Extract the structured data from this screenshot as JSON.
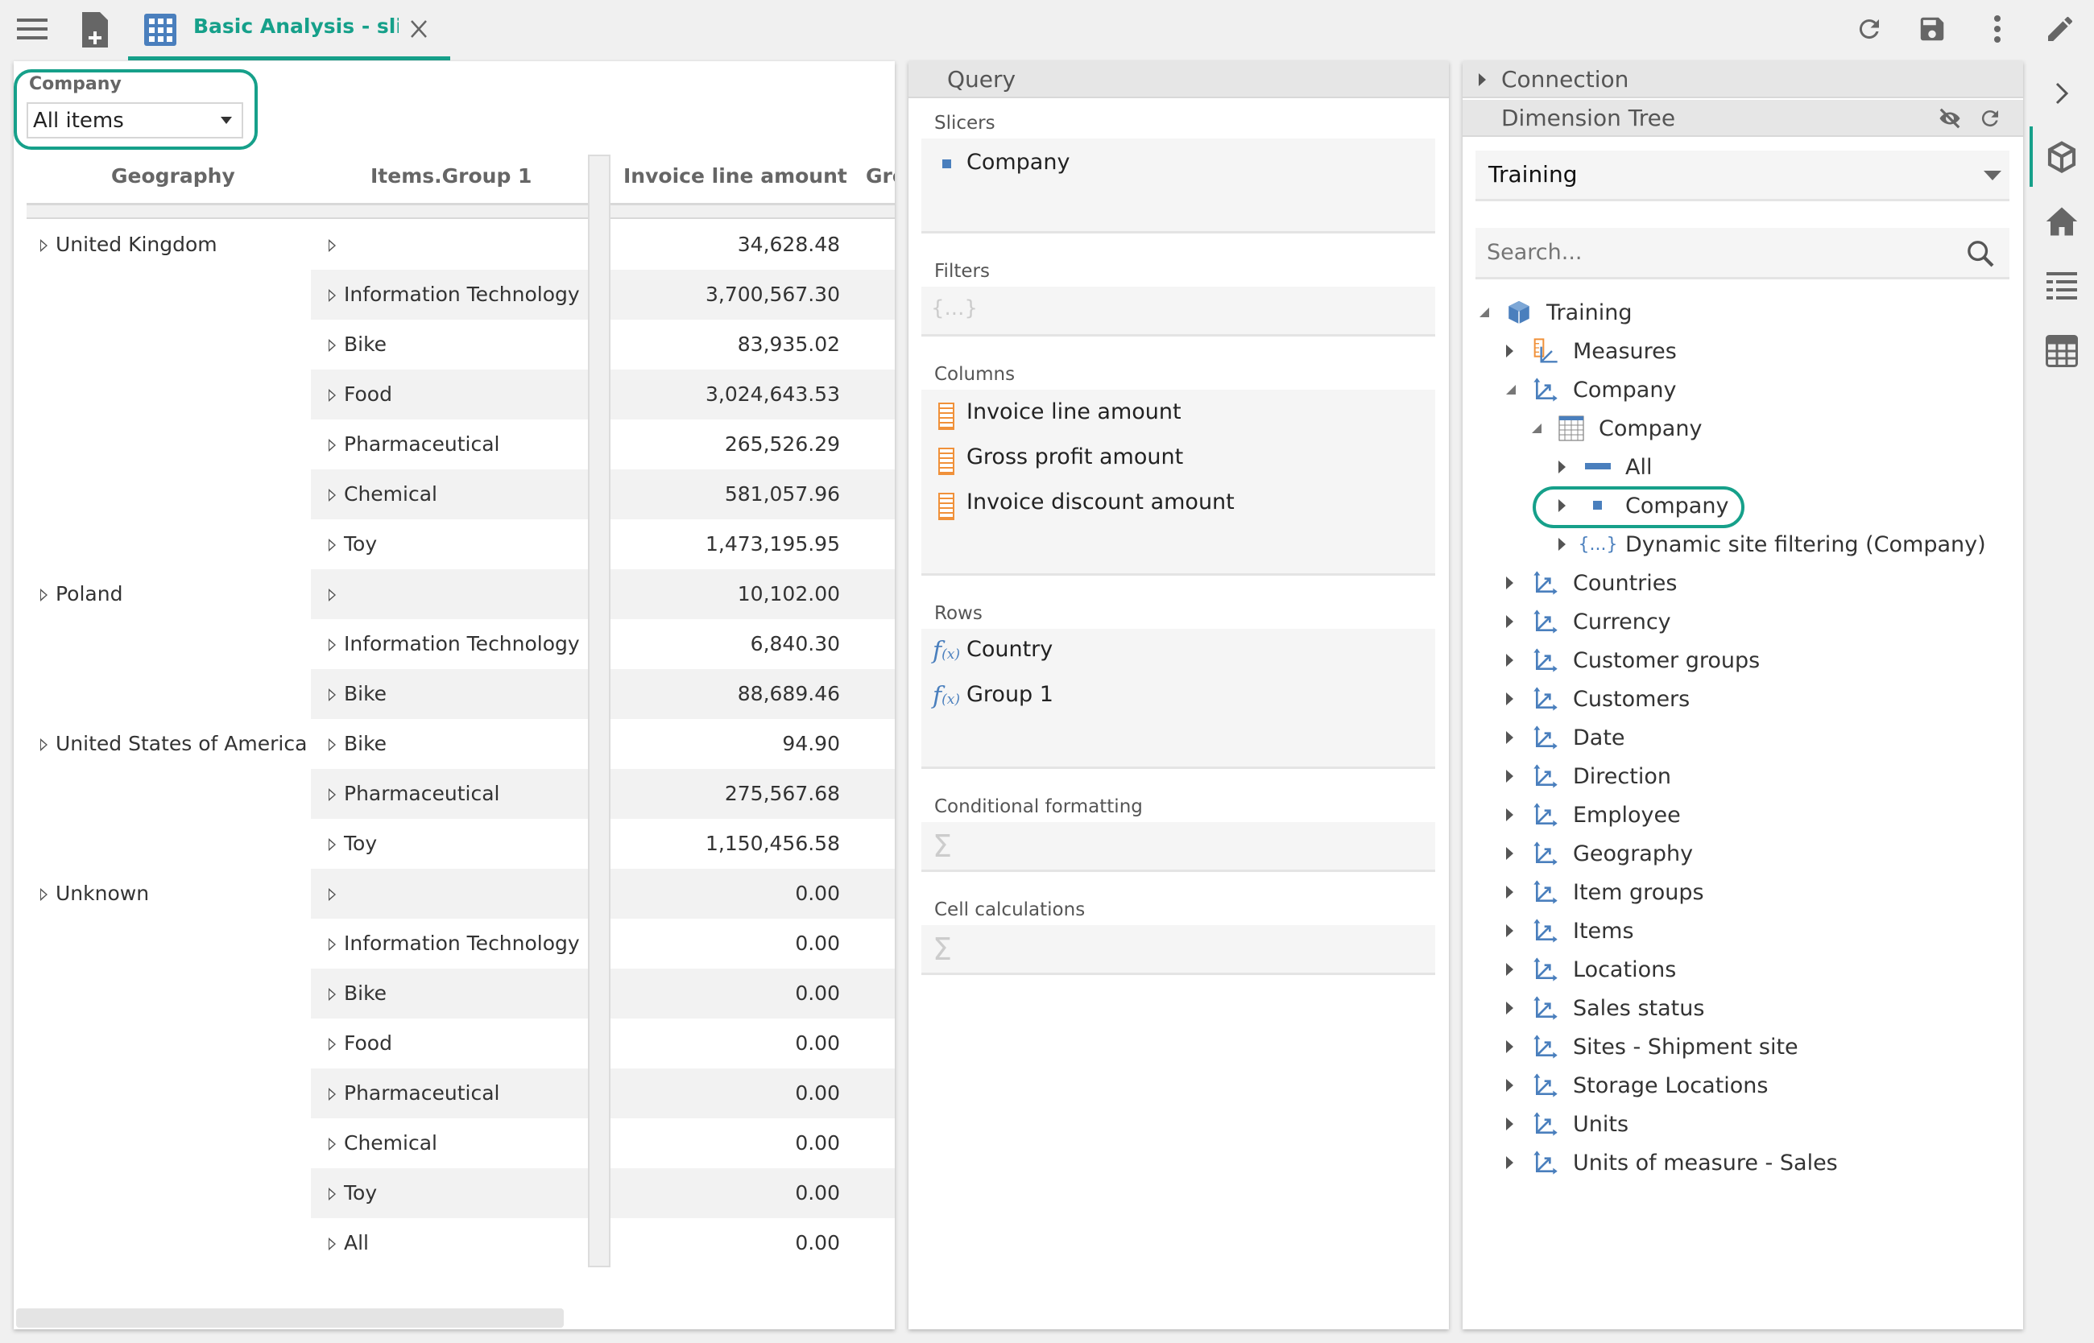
{
  "toolbar": {
    "tab_title": "Basic Analysis - sliced",
    "icons": [
      "hamburger-menu-icon",
      "new-document-icon",
      "grid-icon",
      "close-icon",
      "refresh-icon",
      "save-icon",
      "more-vertical-icon",
      "pencil-icon"
    ]
  },
  "slicer": {
    "label": "Company",
    "value": "All items"
  },
  "table": {
    "headers": [
      "Geography",
      "Items.Group 1",
      "Invoice line amount",
      "Gro"
    ],
    "rows": [
      [
        "United Kingdom",
        "",
        "34,628.48"
      ],
      [
        "",
        "Information Technology",
        "3,700,567.30"
      ],
      [
        "",
        "Bike",
        "83,935.02"
      ],
      [
        "",
        "Food",
        "3,024,643.53"
      ],
      [
        "",
        "Pharmaceutical",
        "265,526.29"
      ],
      [
        "",
        "Chemical",
        "581,057.96"
      ],
      [
        "",
        "Toy",
        "1,473,195.95"
      ],
      [
        "Poland",
        "",
        "10,102.00"
      ],
      [
        "",
        "Information Technology",
        "6,840.30"
      ],
      [
        "",
        "Bike",
        "88,689.46"
      ],
      [
        "United States of America",
        "Bike",
        "94.90"
      ],
      [
        "",
        "Pharmaceutical",
        "275,567.68"
      ],
      [
        "",
        "Toy",
        "1,150,456.58"
      ],
      [
        "Unknown",
        "",
        "0.00"
      ],
      [
        "",
        "Information Technology",
        "0.00"
      ],
      [
        "",
        "Bike",
        "0.00"
      ],
      [
        "",
        "Food",
        "0.00"
      ],
      [
        "",
        "Pharmaceutical",
        "0.00"
      ],
      [
        "",
        "Chemical",
        "0.00"
      ],
      [
        "",
        "Toy",
        "0.00"
      ],
      [
        "",
        "All",
        "0.00"
      ]
    ]
  },
  "query": {
    "title": "Query",
    "slicers_label": "Slicers",
    "slicers": [
      "Company"
    ],
    "filters_label": "Filters",
    "columns_label": "Columns",
    "columns": [
      "Invoice line amount",
      "Gross profit amount",
      "Invoice discount amount"
    ],
    "rows_label": "Rows",
    "rows": [
      "Country",
      "Group 1"
    ],
    "cond_label": "Conditional formatting",
    "calc_label": "Cell calculations"
  },
  "dimension": {
    "connection": "Connection",
    "title": "Dimension Tree",
    "cube": "Training",
    "search_placeholder": "Search...",
    "tree": [
      {
        "label": "Training",
        "level": 0,
        "icon": "cube-icon",
        "expanded": true
      },
      {
        "label": "Measures",
        "level": 1,
        "icon": "measures-icon",
        "expanded": false
      },
      {
        "label": "Company",
        "level": 1,
        "icon": "dimension-icon",
        "expanded": true
      },
      {
        "label": "Company",
        "level": 2,
        "icon": "hierarchy-table-icon",
        "expanded": true
      },
      {
        "label": "All",
        "level": 3,
        "icon": "level-all-icon",
        "expanded": false
      },
      {
        "label": "Company",
        "level": 3,
        "icon": "level-icon",
        "expanded": false,
        "highlighted": true
      },
      {
        "label": "Dynamic site filtering (Company)",
        "level": 3,
        "icon": "set-icon",
        "expanded": false
      },
      {
        "label": "Countries",
        "level": 1,
        "icon": "dimension-icon"
      },
      {
        "label": "Currency",
        "level": 1,
        "icon": "dimension-icon"
      },
      {
        "label": "Customer groups",
        "level": 1,
        "icon": "dimension-icon"
      },
      {
        "label": "Customers",
        "level": 1,
        "icon": "dimension-icon"
      },
      {
        "label": "Date",
        "level": 1,
        "icon": "dimension-icon"
      },
      {
        "label": "Direction",
        "level": 1,
        "icon": "dimension-icon"
      },
      {
        "label": "Employee",
        "level": 1,
        "icon": "dimension-icon"
      },
      {
        "label": "Geography",
        "level": 1,
        "icon": "dimension-icon"
      },
      {
        "label": "Item groups",
        "level": 1,
        "icon": "dimension-icon"
      },
      {
        "label": "Items",
        "level": 1,
        "icon": "dimension-icon"
      },
      {
        "label": "Locations",
        "level": 1,
        "icon": "dimension-icon"
      },
      {
        "label": "Sales status",
        "level": 1,
        "icon": "dimension-icon"
      },
      {
        "label": "Sites - Shipment site",
        "level": 1,
        "icon": "dimension-icon"
      },
      {
        "label": "Storage Locations",
        "level": 1,
        "icon": "dimension-icon"
      },
      {
        "label": "Units",
        "level": 1,
        "icon": "dimension-icon"
      },
      {
        "label": "Units of measure - Sales",
        "level": 1,
        "icon": "dimension-icon"
      }
    ]
  },
  "colors": {
    "accent": "#16a08a",
    "icon_blue": "#4a7fbd",
    "measure_orange": "#f0913a"
  }
}
